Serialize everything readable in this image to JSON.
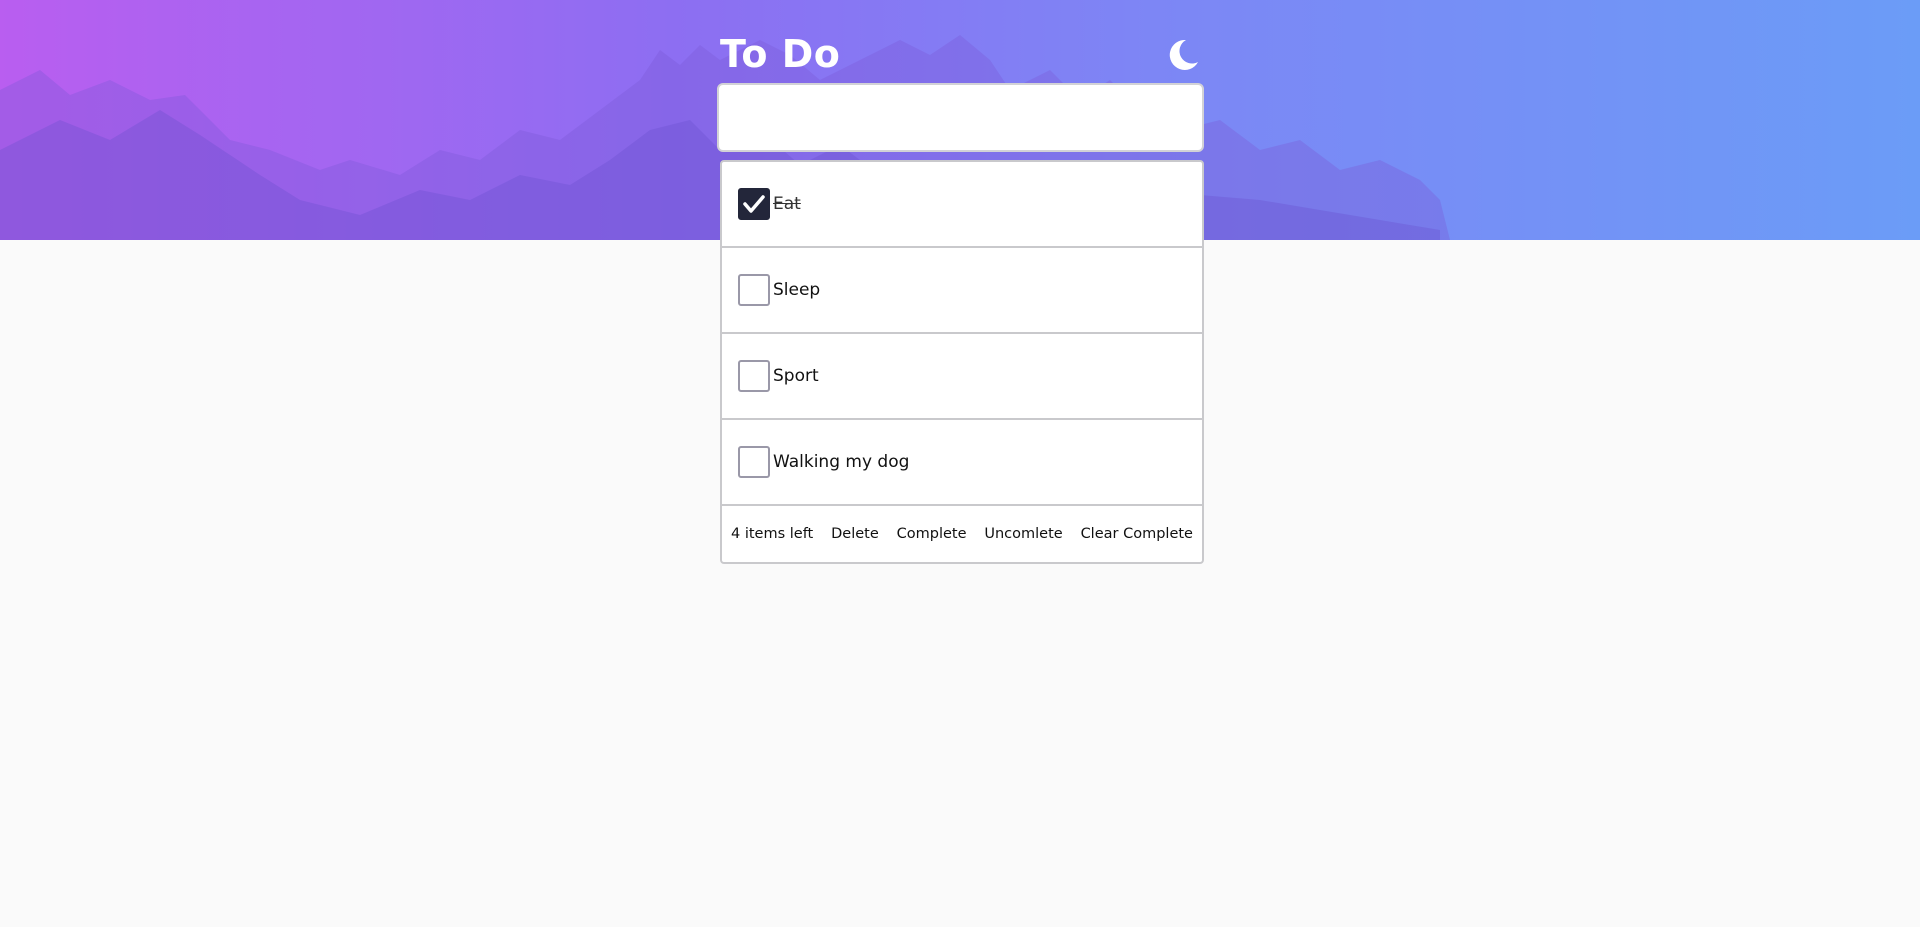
{
  "app": {
    "title": "To Do",
    "theme_icon": "moon-icon"
  },
  "new_todo": {
    "value": "",
    "placeholder": ""
  },
  "todos": [
    {
      "label": "Eat",
      "completed": true
    },
    {
      "label": "Sleep",
      "completed": false
    },
    {
      "label": "Sport",
      "completed": false
    },
    {
      "label": "Walking my dog",
      "completed": false
    }
  ],
  "footer": {
    "items_left": "4 items left",
    "delete_label": "Delete",
    "complete_label": "Complete",
    "uncomplete_label": "Uncomlete",
    "clear_complete_label": "Clear Complete"
  },
  "colors": {
    "gradient_start": "#b95ef0",
    "gradient_end": "#6b9cf7",
    "checkbox_checked": "#23263a",
    "background": "#fafafa"
  }
}
